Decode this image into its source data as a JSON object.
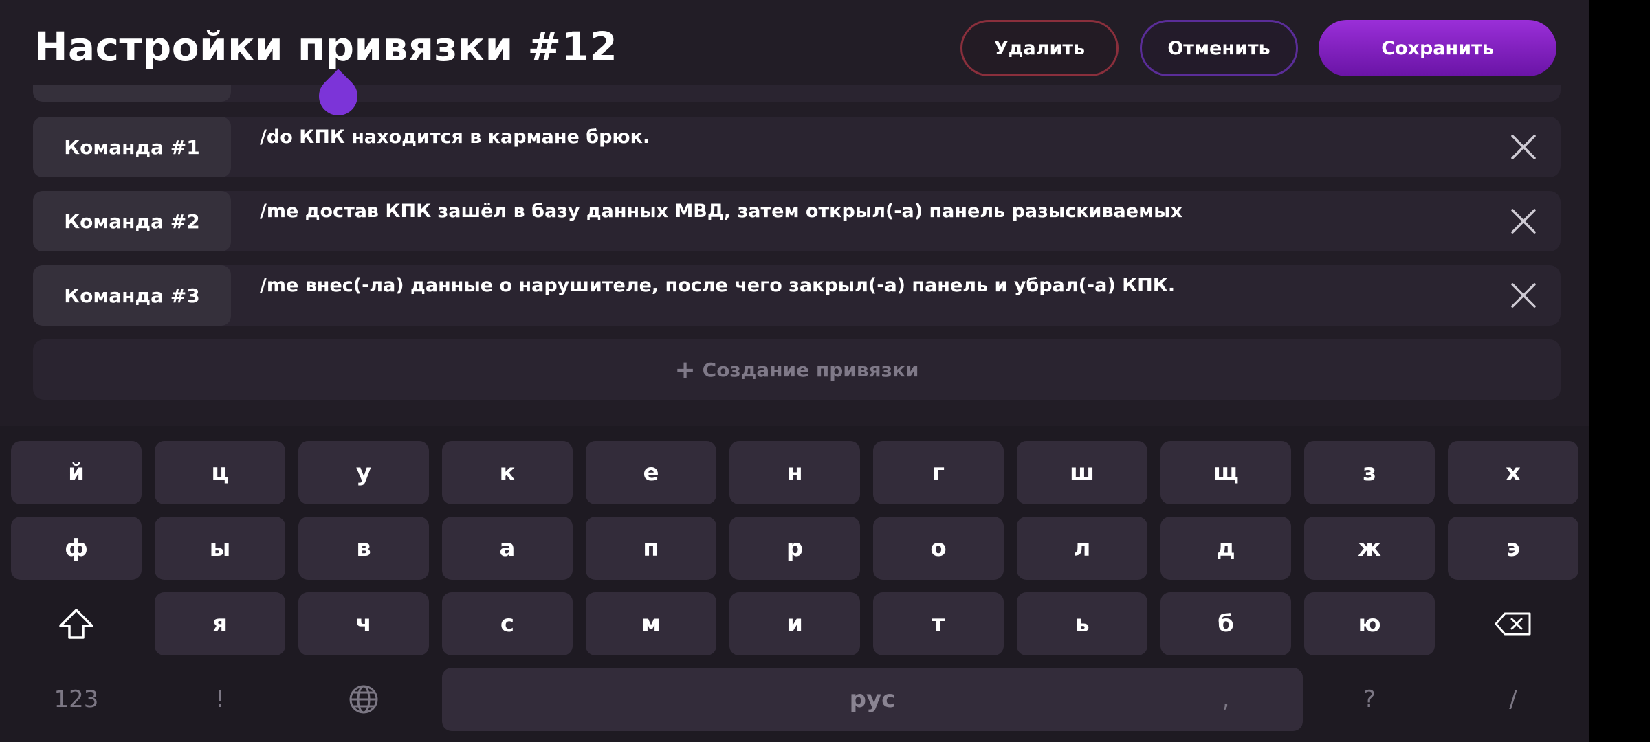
{
  "header": {
    "title": "Настройки привязки #12",
    "delete_label": "Удалить",
    "cancel_label": "Отменить",
    "save_label": "Сохранить"
  },
  "commands": [
    {
      "label": "Команда #1",
      "text": "/do КПК находится в кармане брюк."
    },
    {
      "label": "Команда #2",
      "text": "/me достав КПК зашёл в базу данных МВД, затем открыл(-а) панель разыскиваемых"
    },
    {
      "label": "Команда #3",
      "text": "/me внес(-ла) данные о нарушителе, после чего закрыл(-а) панель и убрал(-а) КПК."
    }
  ],
  "create": {
    "plus": "+",
    "label": "Создание привязки"
  },
  "keyboard": {
    "row1": [
      "й",
      "ц",
      "у",
      "к",
      "е",
      "н",
      "г",
      "ш",
      "щ",
      "з",
      "х"
    ],
    "row2": [
      "ф",
      "ы",
      "в",
      "а",
      "п",
      "р",
      "о",
      "л",
      "д",
      "ж",
      "э"
    ],
    "row3": [
      "я",
      "ч",
      "с",
      "м",
      "и",
      "т",
      "ь",
      "б",
      "ю"
    ],
    "bottom": {
      "numbers": "123",
      "exclaim": "!",
      "space": "рус",
      "comma": ",",
      "question": "?",
      "slash": "/"
    },
    "icons": {
      "shift": "shift-icon",
      "backspace": "backspace-icon",
      "globe": "globe-icon"
    }
  },
  "colors": {
    "accent": "#7c34d8",
    "delete_border": "#8a2f3c",
    "background": "#221d26"
  }
}
